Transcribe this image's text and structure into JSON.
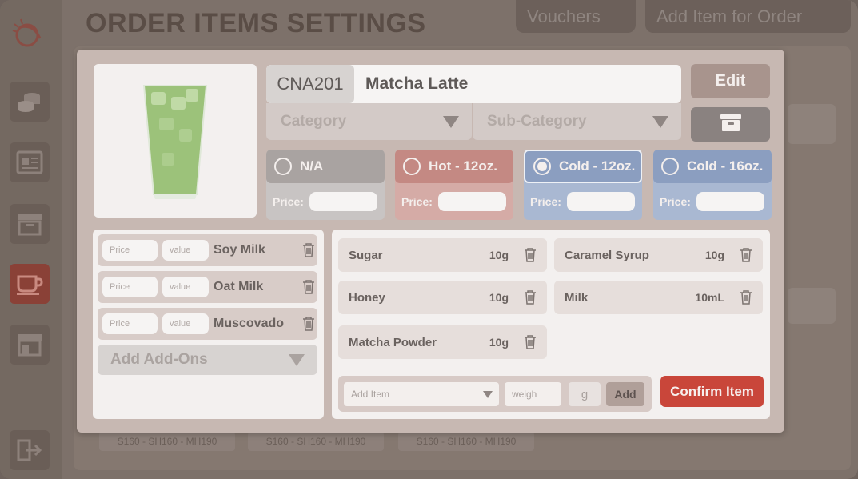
{
  "background": {
    "title": "ORDER ITEMS SETTINGS",
    "top_buttons": [
      "Vouchers",
      "Add Item for Order"
    ],
    "chips": [
      "S160 - SH160 - MH190",
      "S160 - SH160 - MH190",
      "S160 - SH160 - MH190"
    ],
    "nav_icons": [
      "logo-icon",
      "coins-icon",
      "report-icon",
      "archive-icon",
      "coffee-cup-icon",
      "store-icon",
      "logout-icon"
    ]
  },
  "modal": {
    "item": {
      "code": "CNA201",
      "name": "Matcha Latte"
    },
    "category_placeholder": "Category",
    "subcategory_placeholder": "Sub-Category",
    "edit_label": "Edit",
    "sizes": [
      {
        "label": "N/A",
        "selected": false,
        "color": "#a9a3a1"
      },
      {
        "label": "Hot - 12oz.",
        "selected": false,
        "color": "#c48983"
      },
      {
        "label": "Cold - 12oz.",
        "selected": true,
        "color": "#8b9ec0"
      },
      {
        "label": "Cold - 16oz.",
        "selected": false,
        "color": "#8b9ec0"
      }
    ],
    "price_label": "Price:",
    "addons": [
      {
        "price_placeholder": "Price",
        "value_placeholder": "value",
        "name": "Soy Milk"
      },
      {
        "price_placeholder": "Price",
        "value_placeholder": "value",
        "name": "Oat Milk"
      },
      {
        "price_placeholder": "Price",
        "value_placeholder": "value",
        "name": "Muscovado"
      }
    ],
    "add_addons_label": "Add Add-Ons",
    "ingredients": [
      {
        "name": "Sugar",
        "qty": "10g"
      },
      {
        "name": "Caramel Syrup",
        "qty": "10g"
      },
      {
        "name": "Honey",
        "qty": "10g"
      },
      {
        "name": "Milk",
        "qty": "10mL"
      },
      {
        "name": "Matcha Powder",
        "qty": "10g"
      }
    ],
    "add_item": {
      "select_placeholder": "Add Item",
      "weigh_placeholder": "weigh",
      "unit": "g",
      "add_label": "Add"
    },
    "confirm_label": "Confirm Item",
    "colors": {
      "confirm": "#c9463a",
      "edit": "#a8948d"
    }
  }
}
